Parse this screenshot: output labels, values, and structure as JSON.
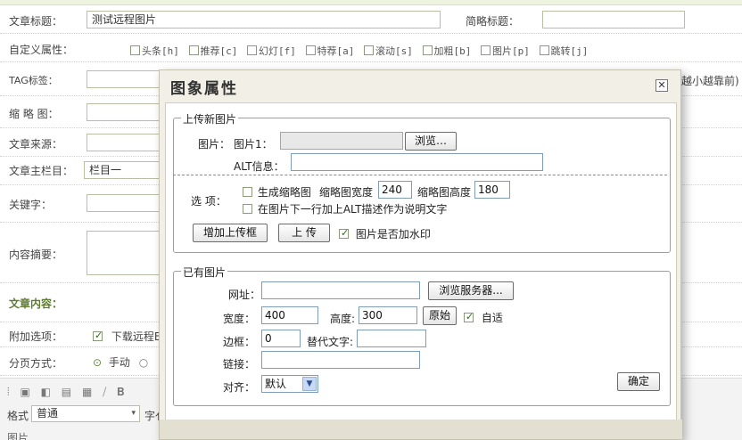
{
  "form": {
    "title_label": "文章标题：",
    "title_value": "测试远程图片",
    "short_title_label": "简略标题：",
    "attr_label": "自定义属性：",
    "attrs": [
      "头条[h]",
      "推荐[c]",
      "幻灯[f]",
      "特荐[a]",
      "滚动[s]",
      "加粗[b]",
      "图片[p]",
      "跳转[j]"
    ],
    "tag_label": "TAG标签：",
    "tag_hint": "越小越靠前)",
    "thumb_label": "缩 略 图：",
    "source_label": "文章来源：",
    "column_label": "文章主栏目：",
    "column_value": "栏目一",
    "keyword_label": "关键字：",
    "summary_label": "内容摘要：",
    "content_label": "文章内容：",
    "extra_label": "附加选项：",
    "extra_option": "下载远程E",
    "paging_label": "分页方式：",
    "paging_manual": "手动",
    "editor_format_label": "格式",
    "editor_format_value": "普通",
    "editor_font_label": "字亻",
    "image_label": "图片"
  },
  "dialog": {
    "title": "图象属性",
    "close_glyph": "✕",
    "upload": {
      "legend": "上传新图片",
      "image_label": "图片：",
      "image1_label": "图片1：",
      "browse_button": "浏览…",
      "alt_label": "ALT信息：",
      "alt_value": "",
      "options_label": "选 项：",
      "gen_thumb_label": "生成缩略图",
      "thumb_width_label": "缩略图宽度",
      "thumb_width_value": "240",
      "thumb_height_label": "缩略图高度",
      "thumb_height_value": "180",
      "alt_desc_label": "在图片下一行加上ALT描述作为说明文字",
      "add_upload_button": "增加上传框",
      "upload_button": "上 传",
      "watermark_label": "图片是否加水印",
      "watermark_checked": true
    },
    "existing": {
      "legend": "已有图片",
      "url_label": "网址：",
      "url_value": "",
      "browse_server_button": "浏览服务器...",
      "width_label": "宽度：",
      "width_value": "400",
      "height_label": "高度:",
      "height_value": "300",
      "original_button": "原始",
      "auto_fit_label": "自适",
      "auto_fit_checked": true,
      "border_label": "边框：",
      "border_value": "0",
      "alt_text_label": "替代文字:",
      "alt_text_value": "",
      "link_label": "链接：",
      "link_value": "",
      "align_label": "对齐：",
      "align_value": "默认",
      "ok_button": "确定"
    }
  }
}
